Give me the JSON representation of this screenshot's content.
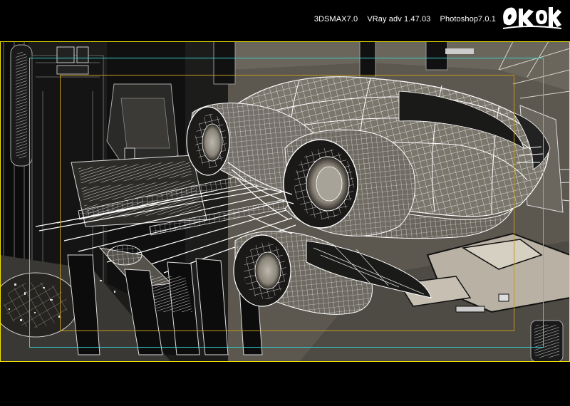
{
  "header": {
    "software": [
      "3DSMAX7.0",
      "VRay adv 1.47.03",
      "Photoshop7.0.1"
    ],
    "logo_text": "Ωkok",
    "text_color": "#ffffff"
  },
  "viewport": {
    "render_mode": "wireframe-on-shaded",
    "colors": {
      "background": "#5c5850",
      "wire": "#ffffff",
      "structure_dark": "#101010",
      "surface_light": "#c6bfb2",
      "viewport_border": "#f2e400",
      "safe_frame_outer": "#33d1cf",
      "safe_frame_inner": "#c49b1c"
    }
  }
}
